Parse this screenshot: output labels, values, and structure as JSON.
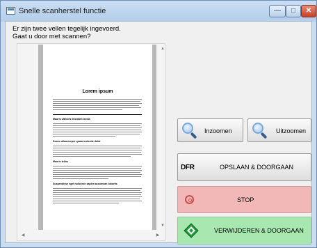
{
  "window": {
    "title": "Snelle scanherstel functie",
    "controls": {
      "minimize": "—",
      "maximize": "□",
      "close": "✕"
    }
  },
  "prompt": {
    "line1": "Er zijn twee vellen tegelijk ingevoerd.",
    "line2": "Gaat u door met scannen?"
  },
  "preview": {
    "doc_title": "Lorem ipsum",
    "headings": [
      "Mauris ultricies tincidunt lectus",
      "Donec ullamcorper quam molestie dolor",
      "Mauris tellus",
      "Suspendisse eget nulla non sapien accumsan lobortis"
    ]
  },
  "buttons": {
    "zoom_in": "Inzoomen",
    "zoom_out": "Uitzoomen",
    "save_continue": "OPSLAAN & DOORGAAN",
    "save_icon_text": "DFR",
    "stop": "STOP",
    "delete_continue": "VERWIJDEREN & DOORGAAN"
  },
  "icons": {
    "zoom_in": "magnifier-icon",
    "zoom_out": "magnifier-icon",
    "save": "dfr-logo-icon",
    "stop": "stop-icon",
    "delete": "green-diamond-arrow-icon"
  },
  "colors": {
    "stop_button": "#f2b8b8",
    "delete_button": "#a8e8b0",
    "close_button": "#c4442a"
  }
}
